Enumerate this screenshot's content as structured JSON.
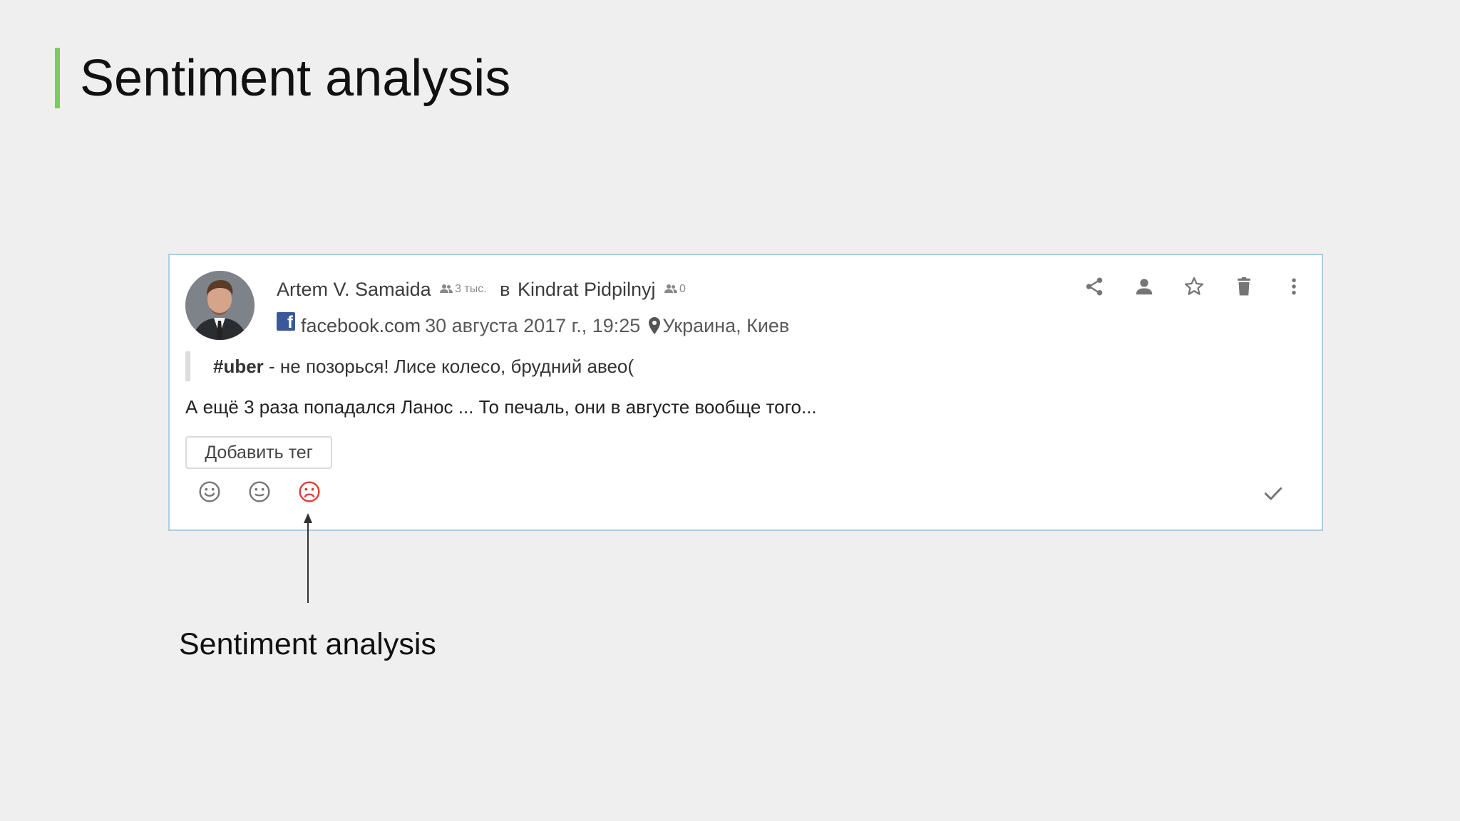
{
  "slide": {
    "title": "Sentiment analysis",
    "accent_color": "#7ccc5a"
  },
  "post": {
    "author_name": "Artem V. Samaida",
    "author_followers": "3 тыс.",
    "in_word": "в",
    "group_name": "Kindrat Pidpilnyj",
    "group_followers": "0",
    "source_icon": "facebook-icon",
    "source": "facebook.com",
    "date": "30 августа 2017 г., 19:25",
    "location": "Украина, Киев",
    "quote_tag": "#uber",
    "quote_text": " - не позорься! Лисе колесо, брудний авео(",
    "body": "А ещё 3 раза попадался Ланос ... То печаль, они в августе вообще того...",
    "add_tag_label": "Добавить тег",
    "actions": [
      "share-icon",
      "person-icon",
      "star-icon",
      "trash-icon",
      "more-vertical-icon"
    ],
    "sentiments": [
      "positive-face-icon",
      "neutral-face-icon",
      "negative-face-icon"
    ],
    "selected_sentiment": "negative",
    "negative_color": "#e53935",
    "card_border_color": "#a9cde4"
  },
  "annotation": {
    "caption": "Sentiment analysis"
  }
}
